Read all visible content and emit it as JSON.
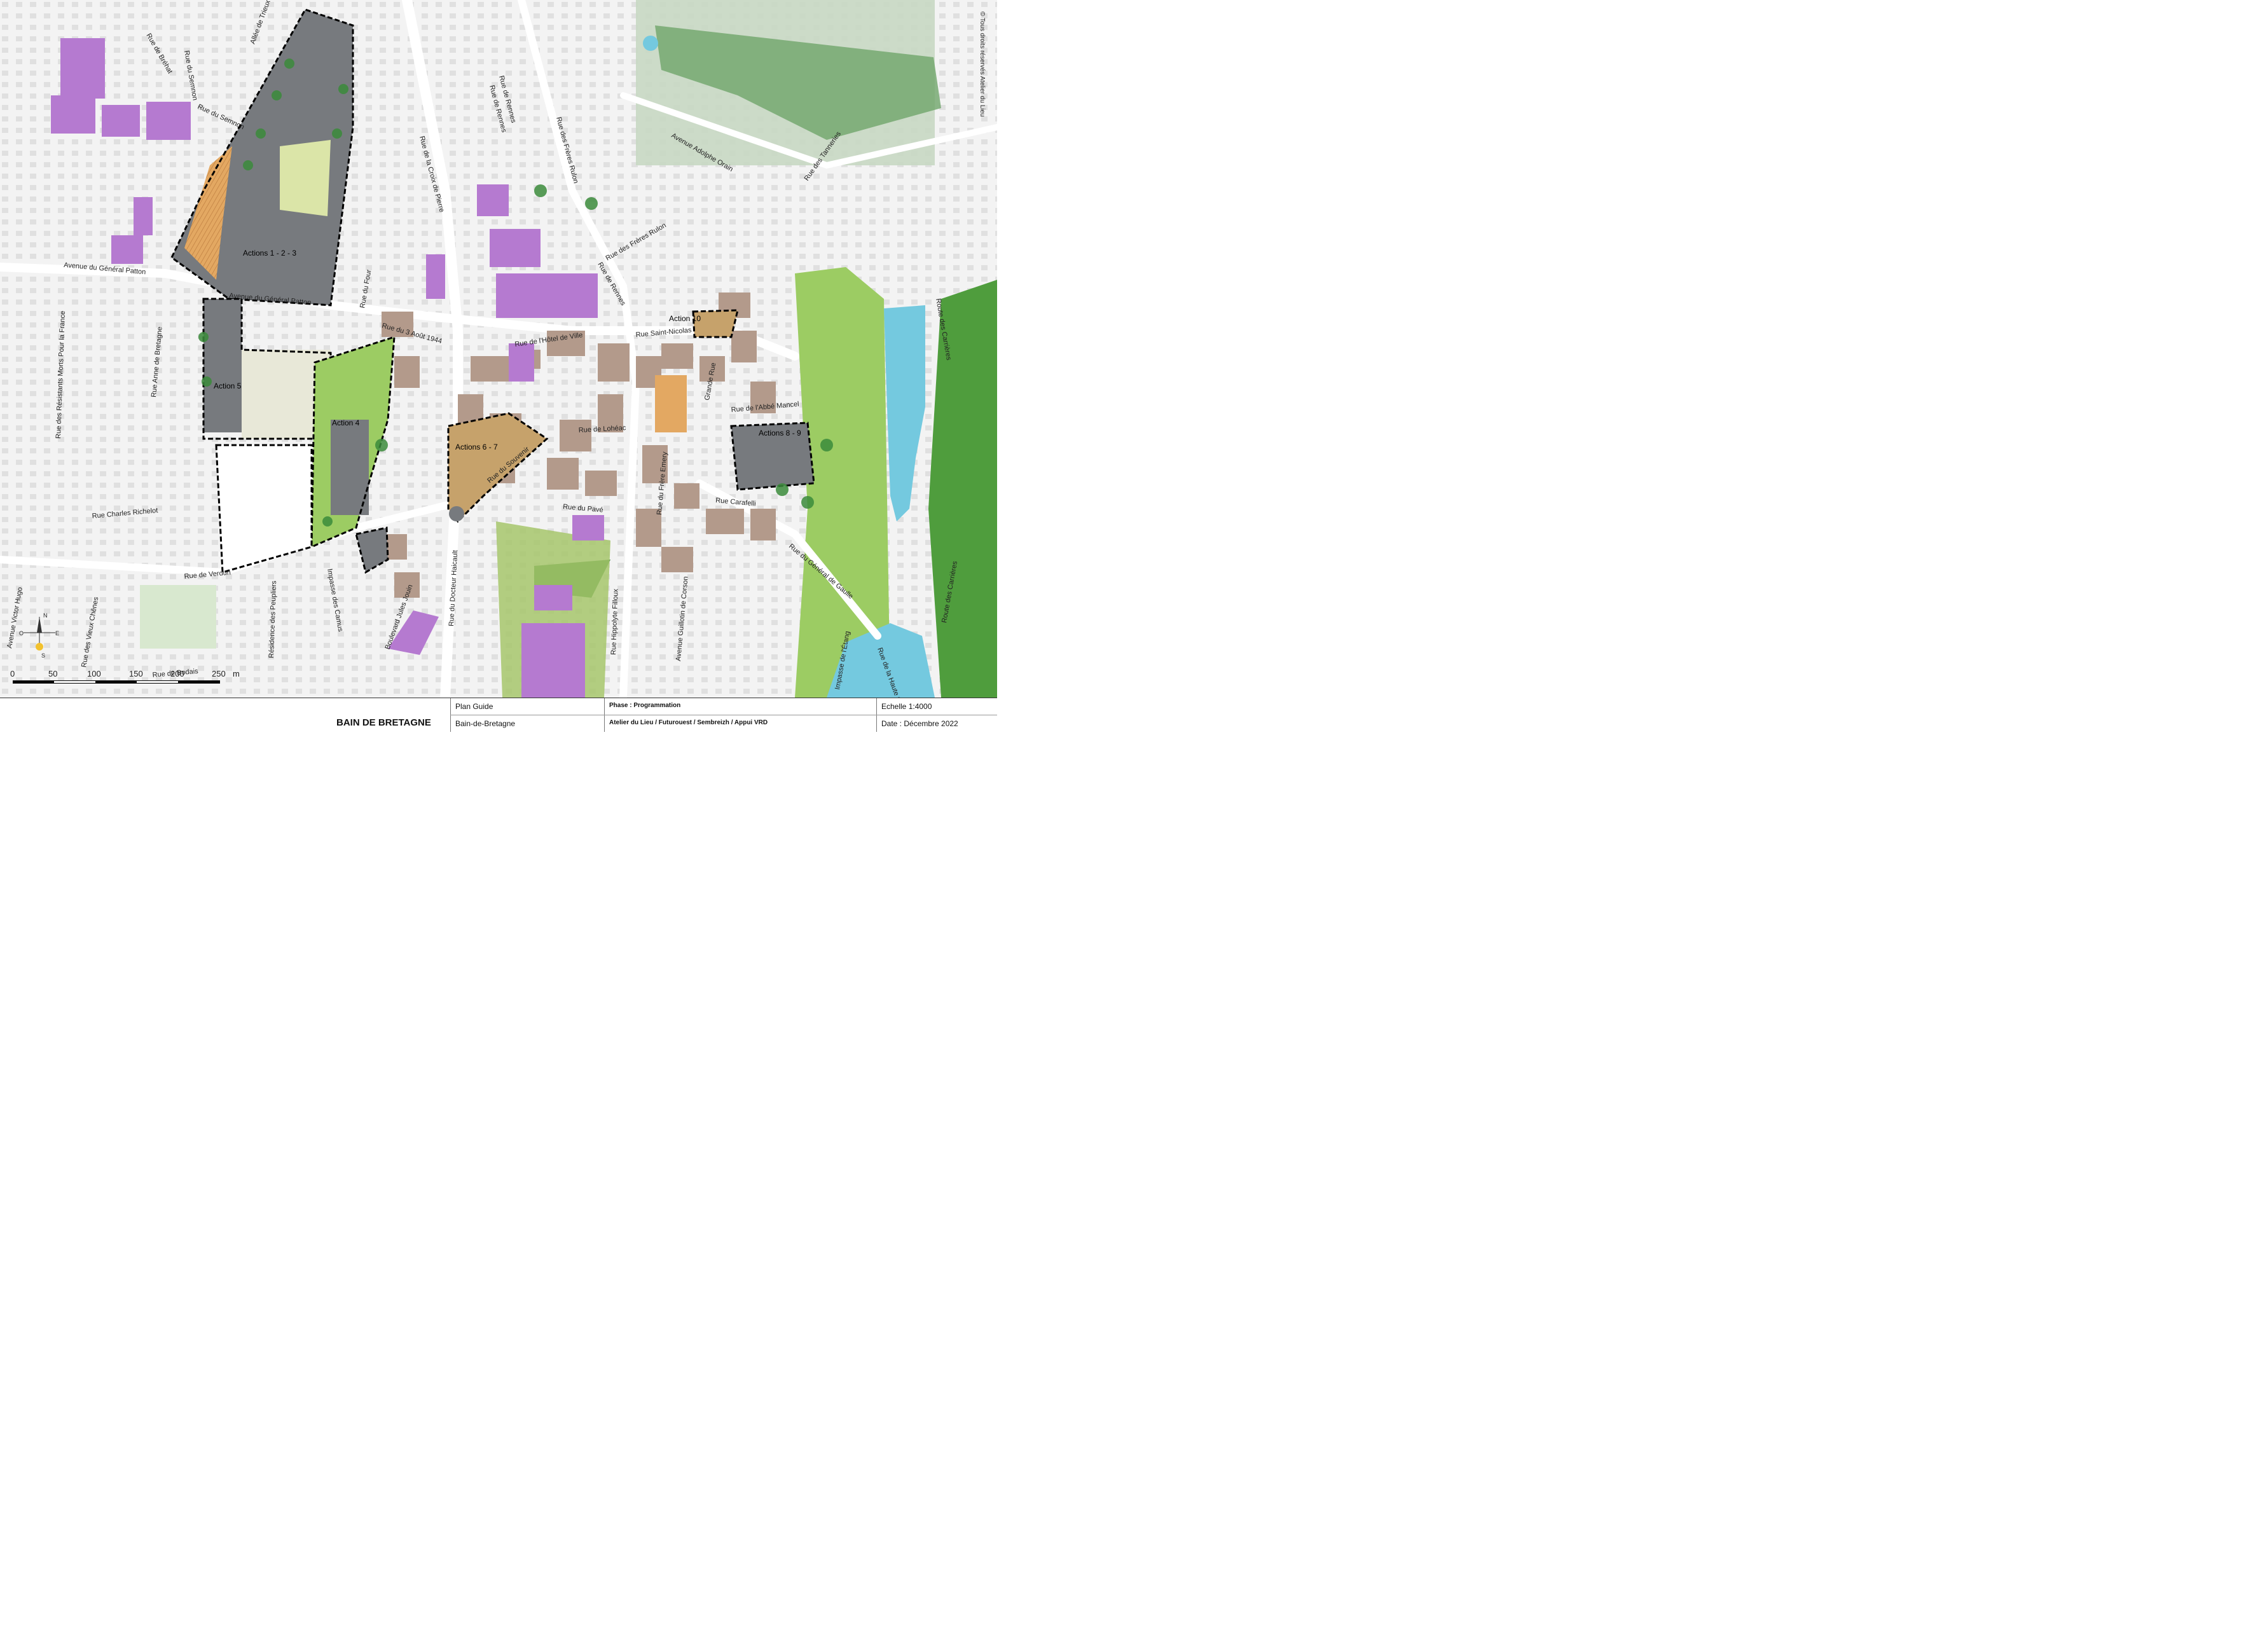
{
  "map": {
    "copyright": "© Tous droits réservés Atelier du Lieu",
    "streets": [
      "Rue de Bréhat",
      "Allée de Trieux",
      "Rue du Semnon",
      "Rue du Semnon",
      "Avenue du Général Patton",
      "Avenue du Général Patton",
      "Rue de Rennes",
      "Rue de Rennes",
      "Rue de la Croix de Pierre",
      "Rue des Frères Rulon",
      "Rue des Frères Rulon",
      "Avenue Adolphe Orain",
      "Rue des Tanneries",
      "Rue de Rennes",
      "Rue du 3 Août 1944",
      "Rue du Four",
      "Rue de l'Hôtel de Ville",
      "Rue Saint-Nicolas",
      "Grande Rue",
      "Rue des Résistants Morts Pour la France",
      "Rue Anne de Bretagne",
      "Rue de l'Abbé Mancel",
      "Rue de Lohéac",
      "Rue Charles Richelot",
      "Rue du Souvenir",
      "Rue du Frère Emery",
      "Rue Carafelli",
      "Rue du Pavé",
      "Rue de Verdun",
      "Rue du Docteur Haicault",
      "Boulevard Jules Jouin",
      "Impasse des Camus",
      "Résidence des Peupliers",
      "Rue des Vieux Chênes",
      "Avenue Victor Hugo",
      "Rue Hippolyte Filloux",
      "Avenue Guillotin de Corson",
      "Rue du Général de Gaulle",
      "Impasse de l'Étang",
      "Rue de la Haute Chapelle",
      "Route des Carrières",
      "Route des Carrières",
      "Rue de Bodais",
      "Rue Coupe"
    ],
    "actions": [
      "Actions 1 - 2 - 3",
      "Action 4",
      "Action 5",
      "Actions 6 - 7",
      "Actions 8 - 9",
      "Action 10"
    ],
    "compass": {
      "n": "N",
      "s": "S",
      "e": "E",
      "o": "O"
    },
    "scale": {
      "ticks": [
        "0",
        "50",
        "100",
        "150",
        "200",
        "250"
      ],
      "unit": "m"
    }
  },
  "cartouche": {
    "town": "BAIN DE BRETAGNE",
    "doc_type": "Plan Guide",
    "commune": "Bain-de-Bretagne",
    "phase": "Phase : Programmation",
    "team": "Atelier du Lieu / Futurouest / Sembreizh / Appui VRD",
    "scale": "Echelle 1:4000",
    "date": "Date : Décembre 2022"
  },
  "colors": {
    "building": "#b39a8b",
    "public": "#b57ad0",
    "green": "#8fbf4f",
    "water": "#74c9df",
    "project": "#777a7e"
  }
}
